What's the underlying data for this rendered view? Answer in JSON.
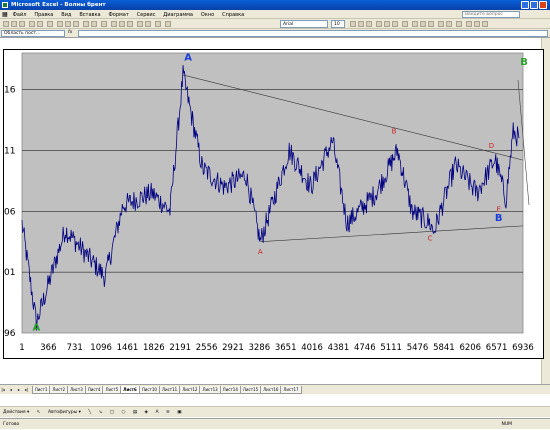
{
  "window": {
    "title": "Microsoft Excel - Волны брент"
  },
  "menu": [
    "Файл",
    "Правка",
    "Вид",
    "Вставка",
    "Формат",
    "Сервис",
    "Диаграмма",
    "Окно",
    "Справка"
  ],
  "help_placeholder": "Введите вопрос",
  "toolbar": {
    "font_name": "Arial",
    "font_size": "10"
  },
  "name_box": "Область пост...",
  "formula_symbol": "fx",
  "sheet_tabs": [
    "Лист1",
    "Лист2",
    "Лист3",
    "Лист4",
    "Лист5",
    "Лист6",
    "Лист10",
    "Лист11",
    "Лист12",
    "Лист13",
    "Лист14",
    "Лист15",
    "Лист16",
    "Лист17"
  ],
  "active_tab_index": 5,
  "draw_toolbar": {
    "actions": "Действия ▾",
    "autoshapes": "Автофигуры ▾"
  },
  "status": {
    "left": "Готово",
    "num": "NUM"
  },
  "chart_data": {
    "type": "line",
    "x_ticks": [
      "1",
      "366",
      "731",
      "1096",
      "1461",
      "1826",
      "2191",
      "2556",
      "2921",
      "3286",
      "3651",
      "4016",
      "4381",
      "4746",
      "5111",
      "5476",
      "5841",
      "6206",
      "6571",
      "6936"
    ],
    "y_ticks": [
      "16",
      "11",
      "06",
      "01",
      "96"
    ],
    "xlim": [
      1,
      6936
    ],
    "ylim": [
      96,
      119
    ],
    "series_color": "#000080",
    "key_points": [
      {
        "x": 1,
        "y": 105.0
      },
      {
        "x": 200,
        "y": 96.8
      },
      {
        "x": 600,
        "y": 104.5
      },
      {
        "x": 1150,
        "y": 100.6
      },
      {
        "x": 1400,
        "y": 106.5
      },
      {
        "x": 1800,
        "y": 107.5
      },
      {
        "x": 2050,
        "y": 106.0
      },
      {
        "x": 2230,
        "y": 117.2
      },
      {
        "x": 2500,
        "y": 109.5
      },
      {
        "x": 2800,
        "y": 108.0
      },
      {
        "x": 3100,
        "y": 109.0
      },
      {
        "x": 3300,
        "y": 103.5
      },
      {
        "x": 3700,
        "y": 111.0
      },
      {
        "x": 4000,
        "y": 108.0
      },
      {
        "x": 4300,
        "y": 111.8
      },
      {
        "x": 4500,
        "y": 105.0
      },
      {
        "x": 4900,
        "y": 107.5
      },
      {
        "x": 5200,
        "y": 111.0
      },
      {
        "x": 5400,
        "y": 106.0
      },
      {
        "x": 5650,
        "y": 105.0
      },
      {
        "x": 5700,
        "y": 104.3
      },
      {
        "x": 6000,
        "y": 109.8
      },
      {
        "x": 6300,
        "y": 107.5
      },
      {
        "x": 6550,
        "y": 110.3
      },
      {
        "x": 6700,
        "y": 107.0
      },
      {
        "x": 6800,
        "y": 112.5
      },
      {
        "x": 6880,
        "y": 112.0
      }
    ],
    "trendlines": [
      {
        "x1": 2230,
        "y1": 117.2,
        "x2": 6936,
        "y2": 110.2
      },
      {
        "x1": 3300,
        "y1": 103.5,
        "x2": 6936,
        "y2": 104.8
      }
    ],
    "wave_labels": [
      {
        "text": "A",
        "x": 200,
        "y": 96.2,
        "color": "#2aa02a"
      },
      {
        "text": "A",
        "x": 2300,
        "y": 118.4,
        "color": "#1a3fd6"
      },
      {
        "text": "A",
        "x": 3300,
        "y": 102.5,
        "color": "#cc2222"
      },
      {
        "text": "B",
        "x": 5150,
        "y": 112.4,
        "color": "#cc2222"
      },
      {
        "text": "C",
        "x": 5650,
        "y": 103.6,
        "color": "#cc2222"
      },
      {
        "text": "D",
        "x": 6500,
        "y": 111.2,
        "color": "#cc2222"
      },
      {
        "text": "E",
        "x": 6600,
        "y": 106.0,
        "color": "#cc2222"
      },
      {
        "text": "B",
        "x": 6600,
        "y": 105.2,
        "color": "#1a3fd6"
      },
      {
        "text": "B",
        "x": 6950,
        "y": 118.0,
        "color": "#2aa02a"
      }
    ]
  }
}
